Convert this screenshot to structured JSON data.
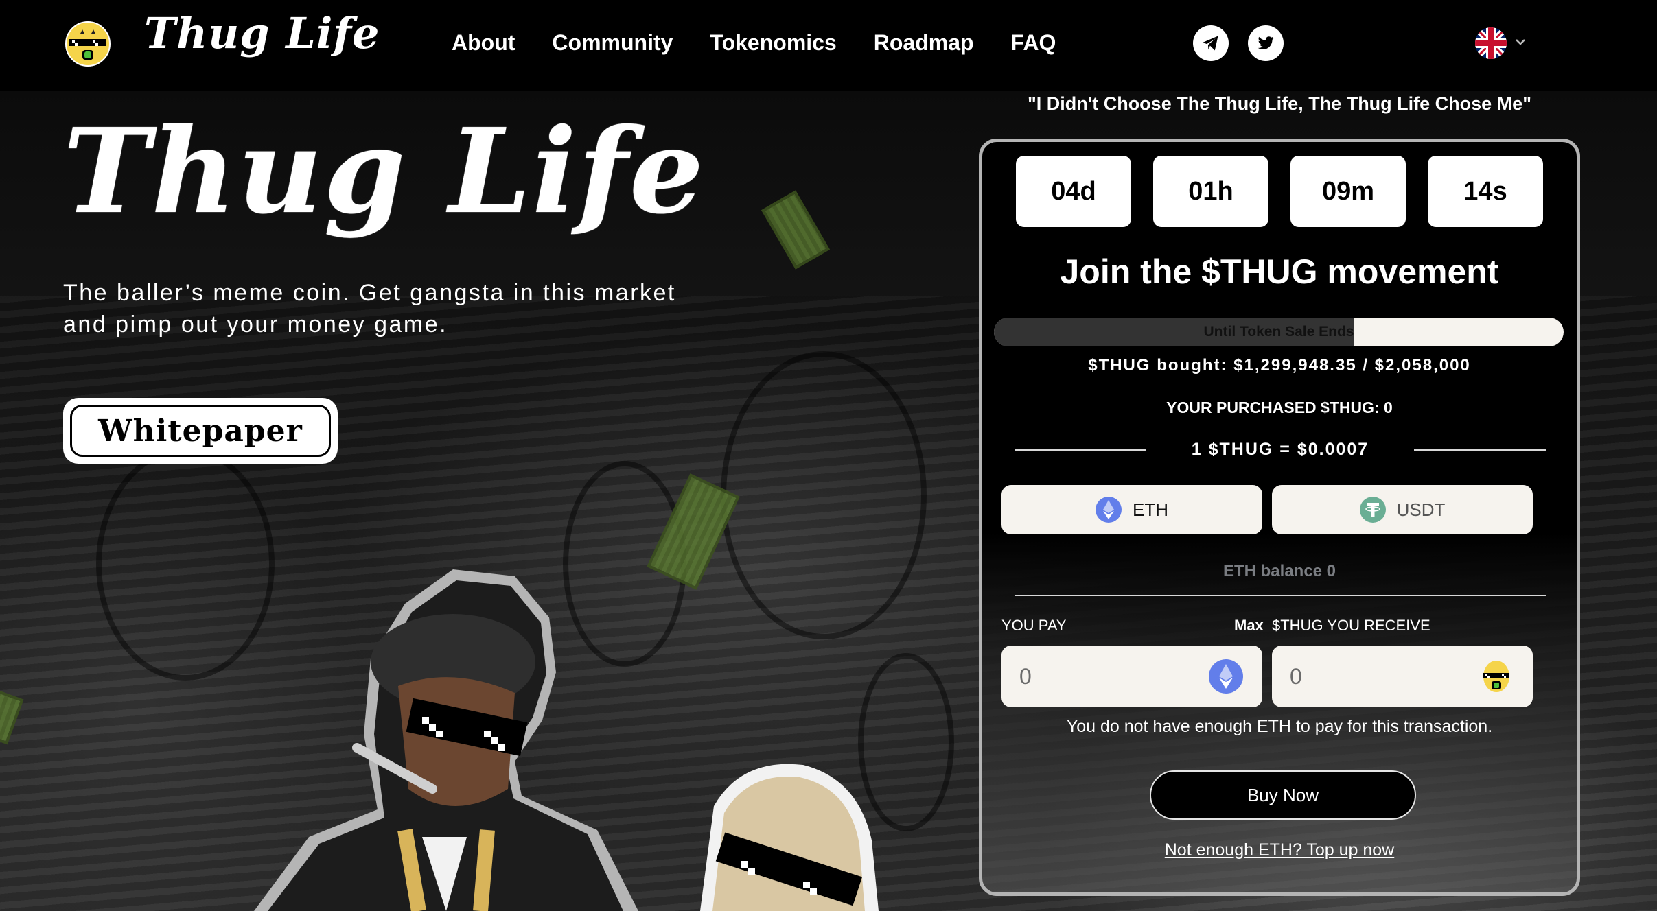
{
  "header": {
    "logo_text": "Thug Life",
    "nav": [
      {
        "label": "About"
      },
      {
        "label": "Community"
      },
      {
        "label": "Tokenomics"
      },
      {
        "label": "Roadmap"
      },
      {
        "label": "FAQ"
      }
    ],
    "social": [
      "telegram-icon",
      "twitter-icon"
    ],
    "language": "uk-flag-icon"
  },
  "hero": {
    "title": "Thug Life",
    "subtitle": "The baller’s meme coin. Get gangsta in this market and pimp out your money game.",
    "whitepaper_label": "Whitepaper"
  },
  "presale": {
    "quote": "\"I Didn't Choose The Thug Life, The Thug Life Chose Me\"",
    "countdown": {
      "days": "04d",
      "hours": "01h",
      "minutes": "09m",
      "seconds": "14s"
    },
    "title": "Join the $THUG movement",
    "progress_label": "Until Token Sale Ends",
    "progress_percent": 63.2,
    "bought_text": "$THUG bought: $1,299,948.35 / $2,058,000",
    "purchased_text": "YOUR PURCHASED $THUG: 0",
    "price_text": "1 $THUG = $0.0007",
    "tokens": [
      {
        "label": "ETH",
        "icon": "eth-icon"
      },
      {
        "label": "USDT",
        "icon": "usdt-icon"
      }
    ],
    "balance_text": "ETH balance 0",
    "pay_label": "YOU PAY",
    "max_label": "Max",
    "receive_label": "$THUG YOU RECEIVE",
    "pay_value": "0",
    "receive_value": "0",
    "error_text": "You do not have enough ETH to pay for this transaction.",
    "buy_label": "Buy Now",
    "topup_label": "Not enough ETH? Top up now"
  },
  "colors": {
    "eth": "#627eea",
    "usdt": "#6aae94",
    "card_border": "#b4b4b4",
    "input_bg": "#f6f3ee"
  }
}
